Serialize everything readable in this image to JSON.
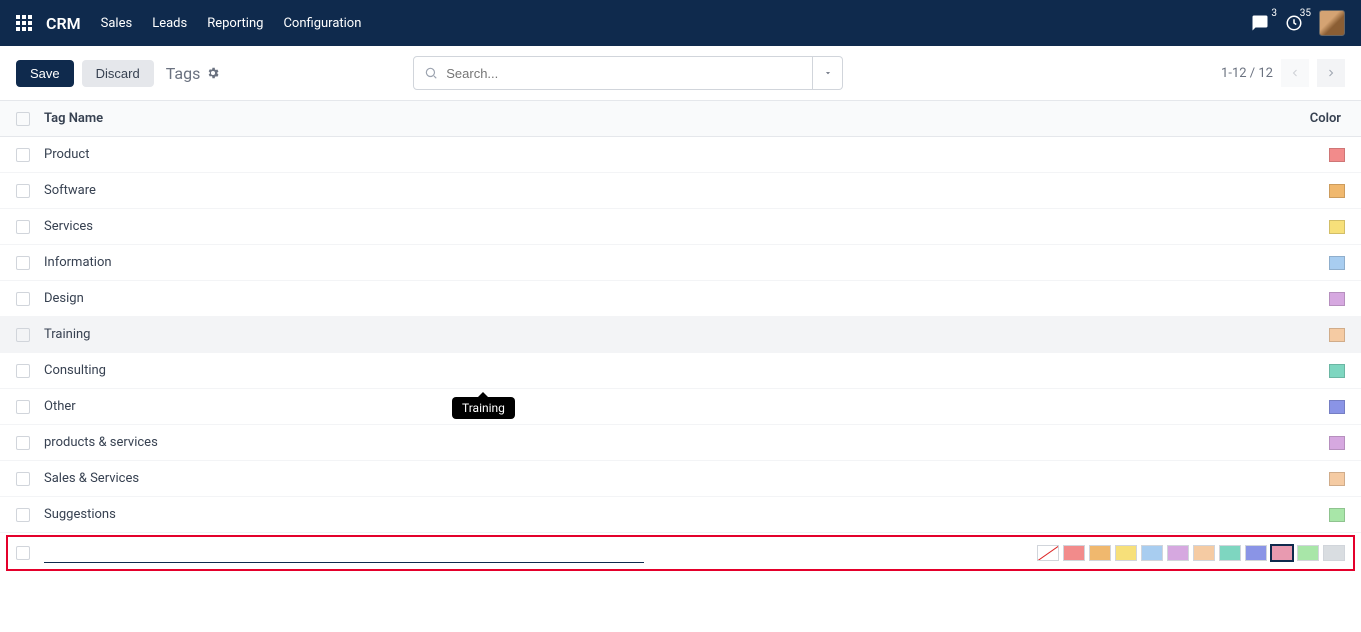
{
  "nav": {
    "brand": "CRM",
    "links": [
      "Sales",
      "Leads",
      "Reporting",
      "Configuration"
    ],
    "chat_badge": "3",
    "activity_badge": "35"
  },
  "toolbar": {
    "save": "Save",
    "discard": "Discard",
    "breadcrumb": "Tags",
    "search_placeholder": "Search...",
    "pager": "1-12 / 12"
  },
  "table": {
    "header_name": "Tag Name",
    "header_color": "Color",
    "rows": [
      {
        "name": "Product",
        "color": "#f28b8b"
      },
      {
        "name": "Software",
        "color": "#f0b86e"
      },
      {
        "name": "Services",
        "color": "#f7e07a"
      },
      {
        "name": "Information",
        "color": "#a8cdf0"
      },
      {
        "name": "Design",
        "color": "#d6a8e0"
      },
      {
        "name": "Training",
        "color": "#f5cba3",
        "hover": true
      },
      {
        "name": "Consulting",
        "color": "#7ed6c0"
      },
      {
        "name": "Other",
        "color": "#8a94e6"
      },
      {
        "name": "products & services",
        "color": "#d6a8e0"
      },
      {
        "name": "Sales & Services",
        "color": "#f5cba3"
      },
      {
        "name": "Suggestions",
        "color": "#a8e6a8"
      }
    ]
  },
  "tooltip": "Training",
  "palette": [
    "none",
    "#f28b8b",
    "#f0b86e",
    "#f7e07a",
    "#a8cdf0",
    "#d6a8e0",
    "#f5cba3",
    "#7ed6c0",
    "#8a94e6",
    "#e89ab0",
    "#a8e6a8",
    "#d9dde1"
  ],
  "palette_selected": 9,
  "edit_value": ""
}
